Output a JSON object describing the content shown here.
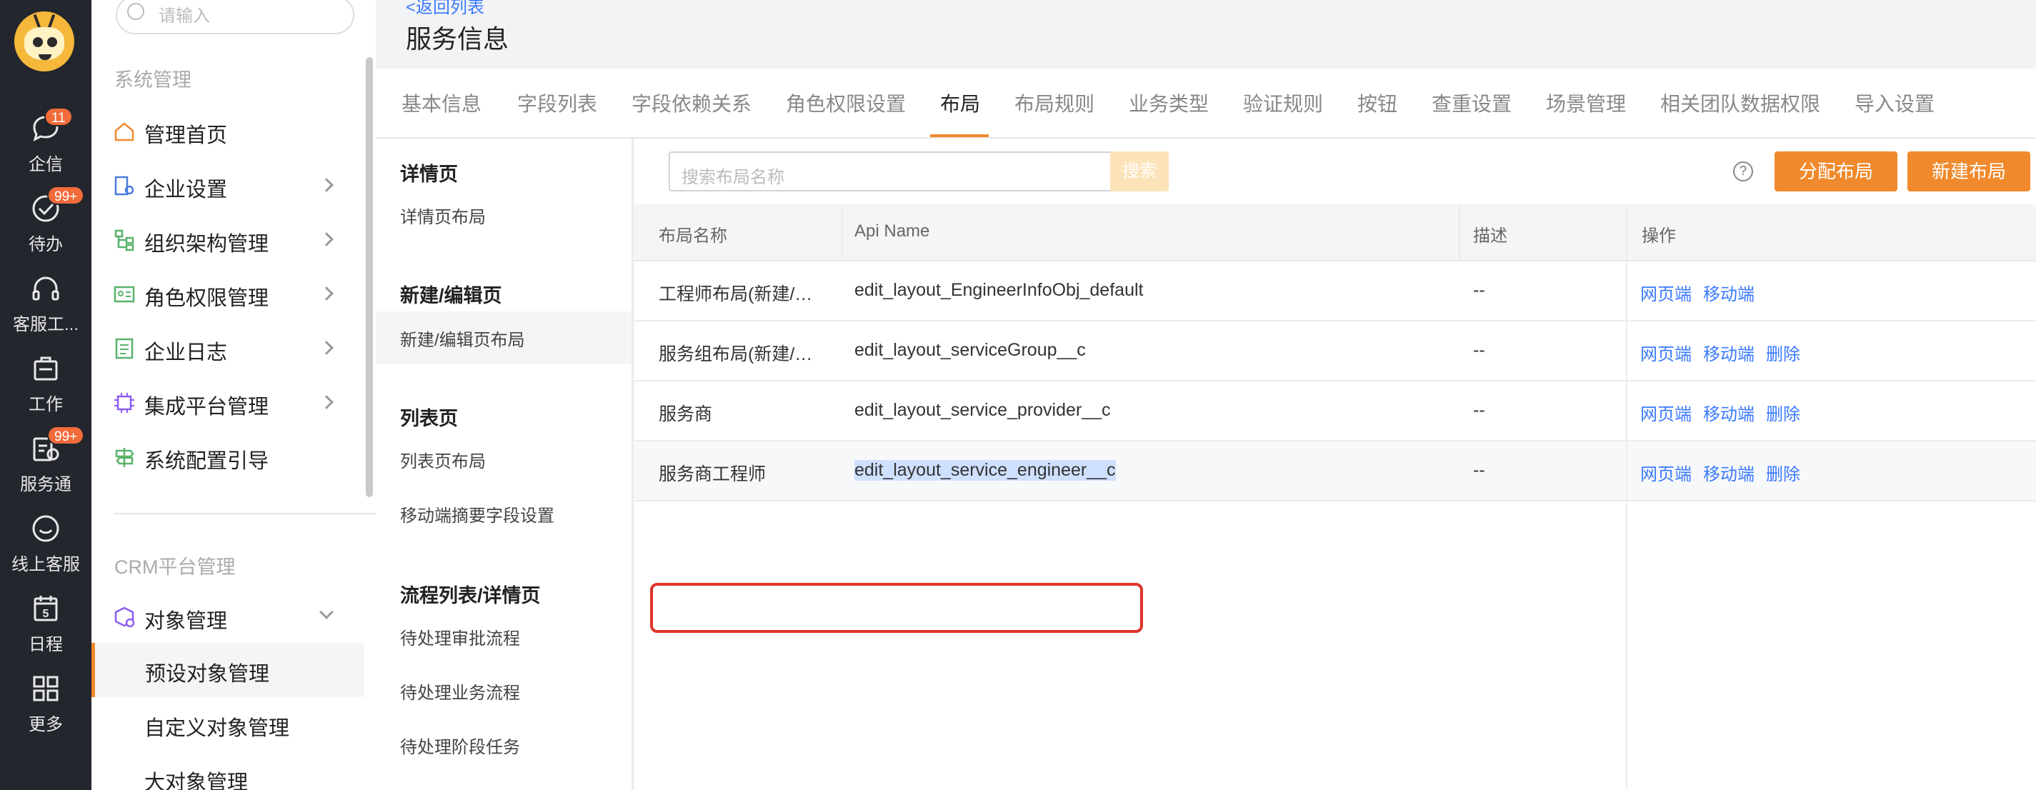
{
  "rail": {
    "items": [
      {
        "label": "企信",
        "icon": "chat-bubble-icon",
        "badge": "11"
      },
      {
        "label": "待办",
        "icon": "check-circle-icon",
        "badge": "99+"
      },
      {
        "label": "客服工...",
        "icon": "headset-icon"
      },
      {
        "label": "工作",
        "icon": "briefcase-icon"
      },
      {
        "label": "服务通",
        "icon": "service-clipboard-icon",
        "badge": "99+"
      },
      {
        "label": "线上客服",
        "icon": "smile-bubble-icon"
      },
      {
        "label": "日程",
        "icon": "calendar-icon",
        "day": "5"
      },
      {
        "label": "更多",
        "icon": "grid-icon"
      }
    ]
  },
  "nav": {
    "search_placeholder": "请输入",
    "section1": "系统管理",
    "items": [
      {
        "label": "管理首页",
        "icon": "home-icon",
        "color": "#f08a2c"
      },
      {
        "label": "企业设置",
        "icon": "building-settings-icon",
        "color": "#4a7bdc"
      },
      {
        "label": "组织架构管理",
        "icon": "org-chart-icon",
        "color": "#59b36b"
      },
      {
        "label": "角色权限管理",
        "icon": "id-card-icon",
        "color": "#59b36b"
      },
      {
        "label": "企业日志",
        "icon": "log-document-icon",
        "color": "#59b36b"
      },
      {
        "label": "集成平台管理",
        "icon": "chip-icon",
        "color": "#8b5cf6"
      },
      {
        "label": "系统配置引导",
        "icon": "signpost-icon",
        "color": "#59b36b"
      }
    ],
    "section2": "CRM平台管理",
    "object_mgmt": "对象管理",
    "sub_items": [
      "预设对象管理",
      "自定义对象管理",
      "大对象管理"
    ]
  },
  "header": {
    "back": "<返回列表",
    "title": "服务信息"
  },
  "tabs": [
    "基本信息",
    "字段列表",
    "字段依赖关系",
    "角色权限设置",
    "布局",
    "布局规则",
    "业务类型",
    "验证规则",
    "按钮",
    "查重设置",
    "场景管理",
    "相关团队数据权限",
    "导入设置"
  ],
  "active_tab": "布局",
  "sub_menu": {
    "groups": [
      {
        "title": "详情页",
        "items": [
          "详情页布局"
        ]
      },
      {
        "title": "新建/编辑页",
        "items": [
          "新建/编辑页布局"
        ]
      },
      {
        "title": "列表页",
        "items": [
          "列表页布局",
          "移动端摘要字段设置"
        ]
      },
      {
        "title": "流程列表/详情页",
        "items": [
          "待处理审批流程",
          "待处理业务流程",
          "待处理阶段任务"
        ]
      }
    ]
  },
  "toolbar": {
    "search_placeholder": "搜索布局名称",
    "search_button": "搜索",
    "help": "?",
    "assign_button": "分配布局",
    "new_button": "新建布局"
  },
  "table": {
    "headers": [
      "布局名称",
      "Api Name",
      "描述",
      "操作"
    ],
    "rows": [
      {
        "name": "工程师布局(新建/编辑页)",
        "api": "edit_layout_EngineerInfoObj_default",
        "desc": "--",
        "actions": [
          "网页端",
          "移动端"
        ]
      },
      {
        "name": "服务组布局(新建/编辑页)",
        "api": "edit_layout_serviceGroup__c",
        "desc": "--",
        "actions": [
          "网页端",
          "移动端",
          "删除"
        ]
      },
      {
        "name": "服务商",
        "api": "edit_layout_service_provider__c",
        "desc": "--",
        "actions": [
          "网页端",
          "移动端",
          "删除"
        ]
      },
      {
        "name": "服务商工程师",
        "api": "edit_layout_service_engineer__c",
        "desc": "--",
        "actions": [
          "网页端",
          "移动端",
          "删除"
        ]
      }
    ]
  }
}
